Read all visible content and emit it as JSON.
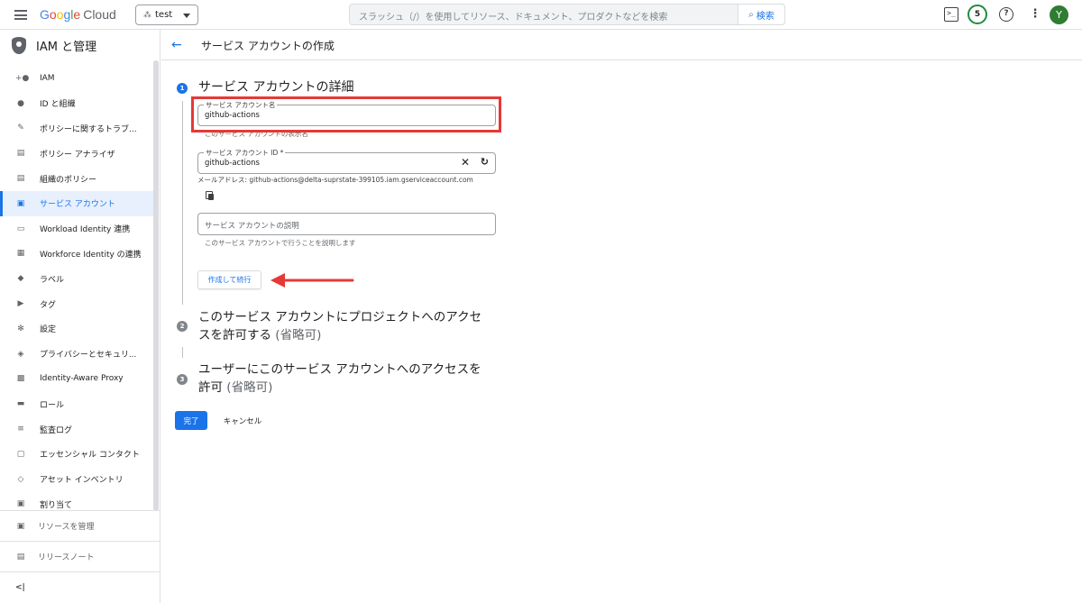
{
  "topbar": {
    "logo": {
      "letters": [
        "G",
        "o",
        "o",
        "g",
        "l",
        "e"
      ],
      "cloud": "Cloud"
    },
    "project": "test",
    "search_placeholder": "スラッシュ（/）を使用してリソース、ドキュメント、プロダクトなどを検索",
    "search_button": "検索",
    "notification_count": "5",
    "avatar_initial": "Y"
  },
  "sidebar": {
    "title": "IAM と管理",
    "items": [
      {
        "label": "IAM",
        "icon": "person-add-icon"
      },
      {
        "label": "ID と組織",
        "icon": "account-circle-icon"
      },
      {
        "label": "ポリシーに関するトラブ...",
        "icon": "wrench-icon"
      },
      {
        "label": "ポリシー アナライザ",
        "icon": "analyzer-icon"
      },
      {
        "label": "組織のポリシー",
        "icon": "list-icon"
      },
      {
        "label": "サービス アカウント",
        "icon": "service-account-icon",
        "active": true
      },
      {
        "label": "Workload Identity 連携",
        "icon": "id-card-icon"
      },
      {
        "label": "Workforce Identity の連携",
        "icon": "workforce-icon"
      },
      {
        "label": "ラベル",
        "icon": "label-icon"
      },
      {
        "label": "タグ",
        "icon": "tag-icon"
      },
      {
        "label": "設定",
        "icon": "gear-icon"
      },
      {
        "label": "プライバシーとセキュリ...",
        "icon": "shield-icon"
      },
      {
        "label": "Identity-Aware Proxy",
        "icon": "proxy-icon"
      },
      {
        "label": "ロール",
        "icon": "role-icon"
      },
      {
        "label": "監査ログ",
        "icon": "audit-log-icon"
      },
      {
        "label": "エッセンシャル コンタクト",
        "icon": "contact-icon"
      },
      {
        "label": "アセット インベントリ",
        "icon": "asset-icon"
      },
      {
        "label": "割り当て",
        "icon": "quota-icon"
      }
    ],
    "manage_resources": "リソースを管理",
    "release_notes": "リリースノート",
    "collapse": "<|"
  },
  "page": {
    "title": "サービス アカウントの作成",
    "step1": {
      "num": "1",
      "title": "サービス アカウントの詳細",
      "name_label": "サービス アカウント名",
      "name_value": "github-actions",
      "name_hint": "このサービス アカウントの表示名",
      "id_label": "サービス アカウント ID *",
      "id_value": "github-actions",
      "email": "メールアドレス: github-actions@delta-suprstate-399105.iam.gserviceaccount.com",
      "desc_placeholder": "サービス アカウントの説明",
      "desc_hint": "このサービス アカウントで行うことを説明します",
      "create_button": "作成して続行"
    },
    "step2": {
      "num": "2",
      "title_line1": "このサービス アカウントにプロジェクトへのアクセ",
      "title_line2": "スを許可する",
      "optional": "(省略可)"
    },
    "step3": {
      "num": "3",
      "title_line1": "ユーザーにこのサービス アカウントへのアクセスを",
      "title_line2": "許可",
      "optional": "(省略可)"
    },
    "done_button": "完了",
    "cancel_button": "キャンセル"
  },
  "colors": {
    "accent": "#1a73e8",
    "highlight": "#e53935"
  }
}
